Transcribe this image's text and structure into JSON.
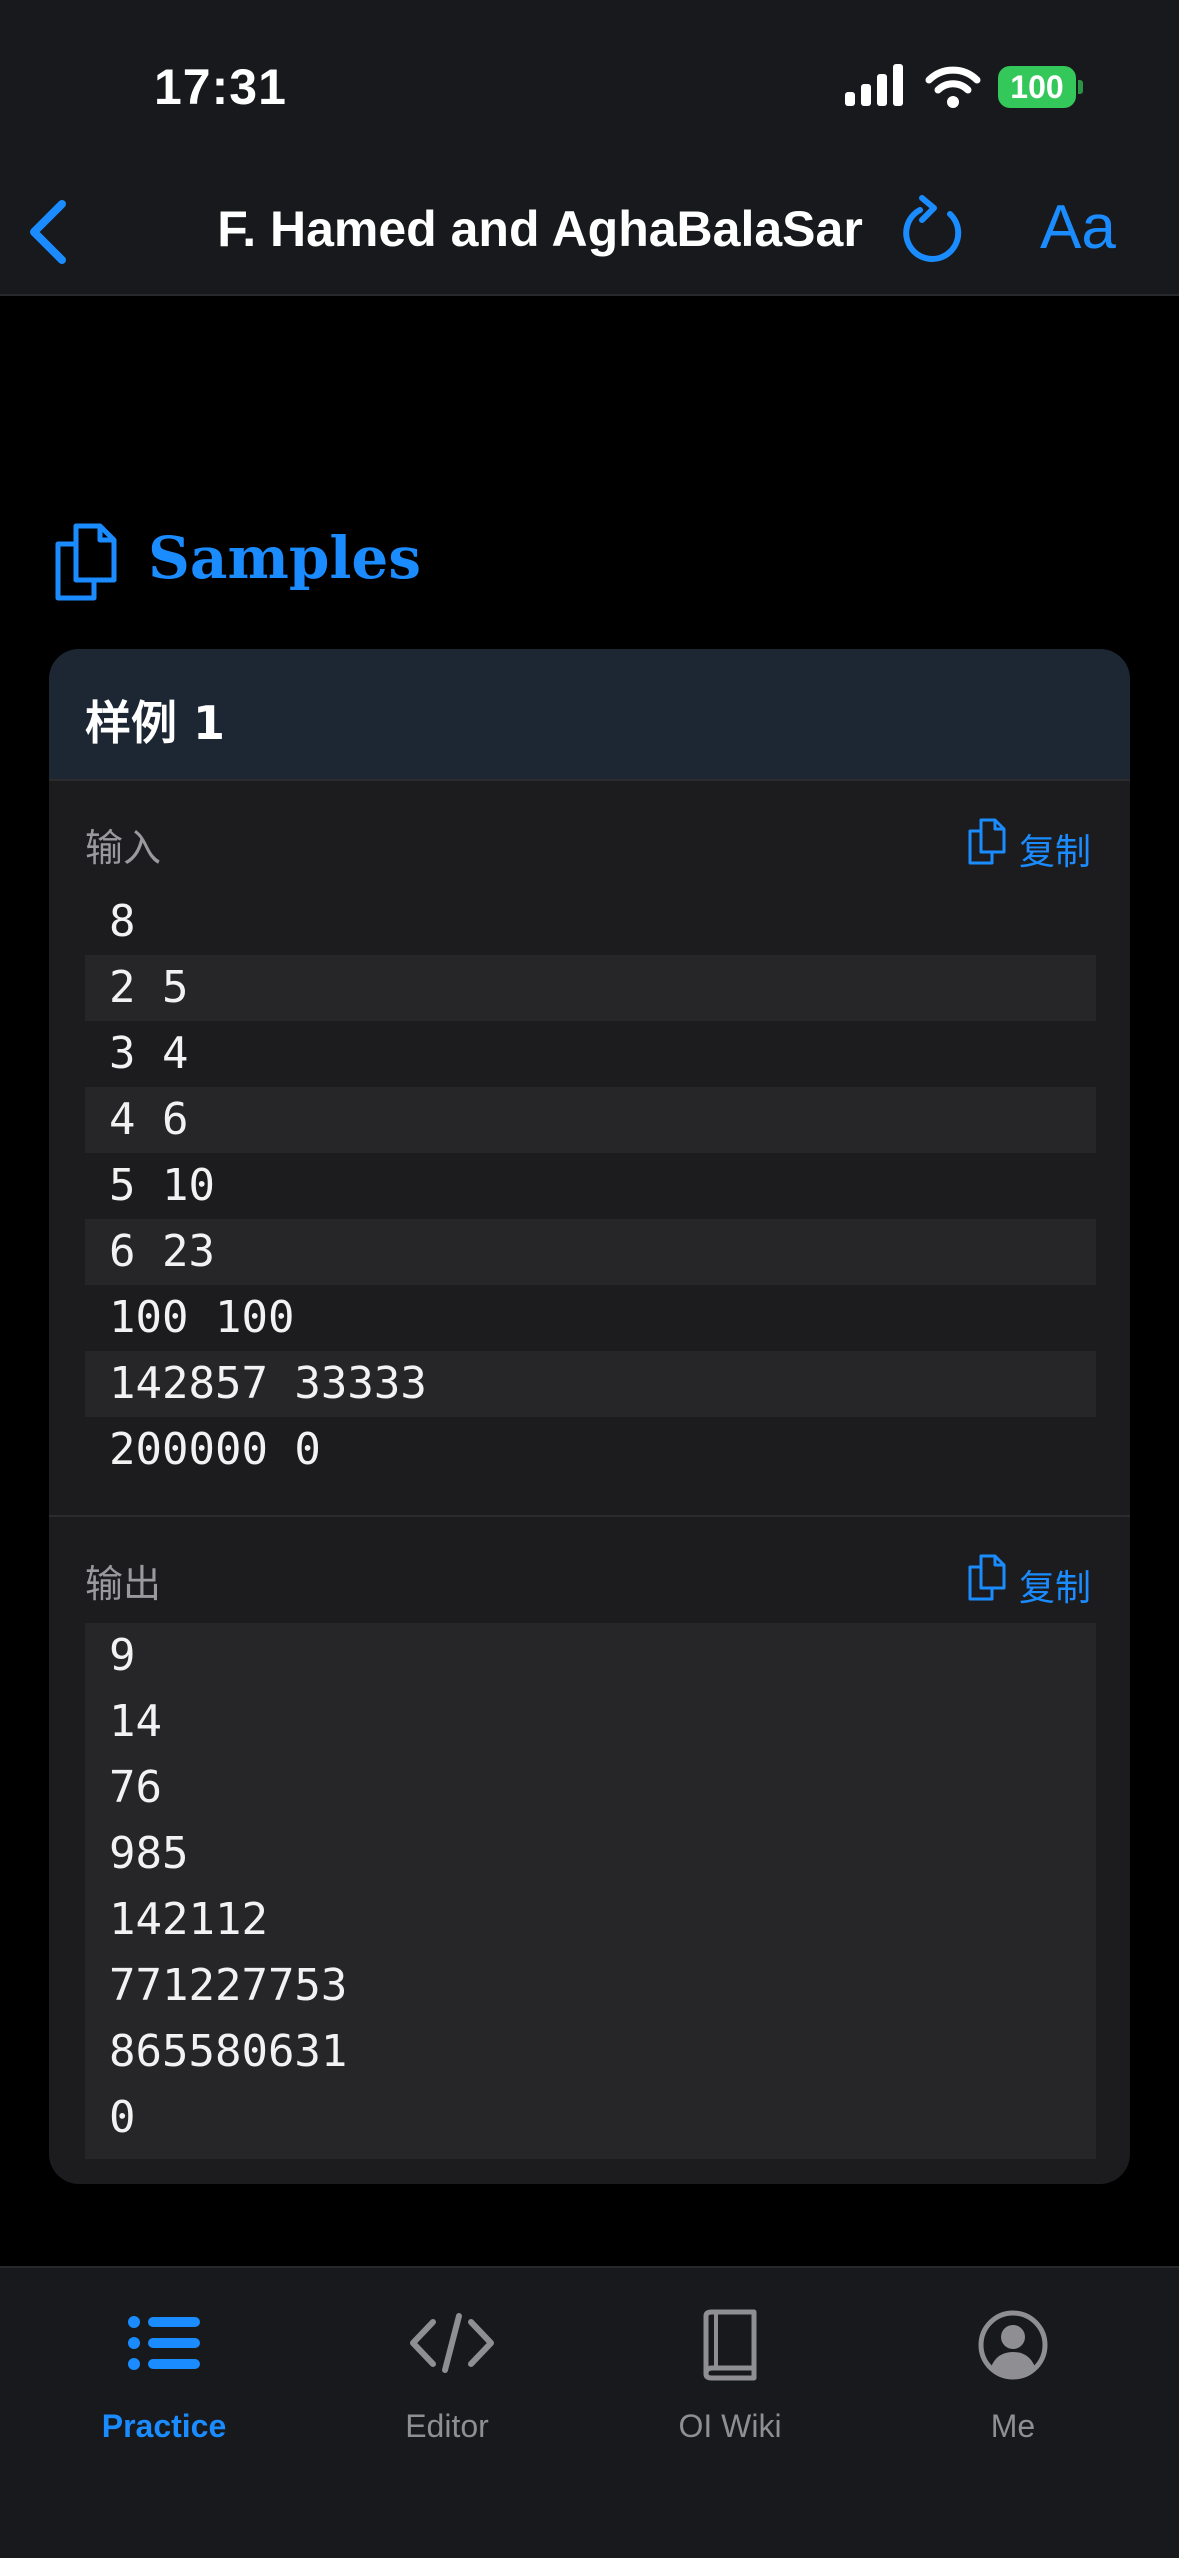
{
  "status_bar": {
    "time": "17:31",
    "battery": "100"
  },
  "nav": {
    "title": "F. Hamed and AghaBalaSar",
    "font_button": "Aa"
  },
  "section": {
    "title": "Samples"
  },
  "sample": {
    "title": "样例 1",
    "input": {
      "label": "输入",
      "copy_label": "复制",
      "lines": [
        "8",
        "2 5",
        "3 4",
        "4 6",
        "5 10",
        "6 23",
        "100 100",
        "142857 33333",
        "200000 0"
      ]
    },
    "output": {
      "label": "输出",
      "copy_label": "复制",
      "lines": [
        "9",
        "14",
        "76",
        "985",
        "142112",
        "771227753",
        "865580631",
        "0"
      ]
    }
  },
  "tabs": [
    {
      "label": "Practice",
      "icon": "list-icon",
      "active": true
    },
    {
      "label": "Editor",
      "icon": "code-icon",
      "active": false
    },
    {
      "label": "OI Wiki",
      "icon": "book-icon",
      "active": false
    },
    {
      "label": "Me",
      "icon": "person-icon",
      "active": false
    }
  ],
  "colors": {
    "accent": "#1a8cff",
    "battery": "#34c759",
    "background": "#000000",
    "card": "#1c1c1e",
    "card_header": "#1c2733"
  }
}
